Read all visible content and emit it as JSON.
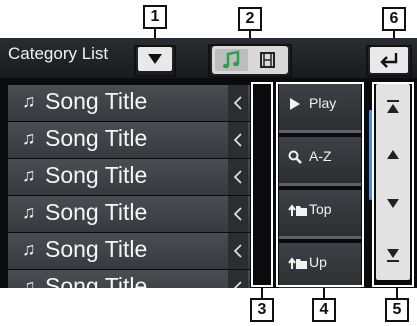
{
  "callouts": [
    "1",
    "2",
    "6",
    "3",
    "4",
    "5"
  ],
  "header": {
    "title": "Category List"
  },
  "list": {
    "items": [
      {
        "icon": "music-note-icon",
        "label": "Song Title"
      },
      {
        "icon": "music-note-icon",
        "label": "Song Title"
      },
      {
        "icon": "music-note-icon",
        "label": "Song Title"
      },
      {
        "icon": "music-note-icon",
        "label": "Song Title"
      },
      {
        "icon": "music-note-icon",
        "label": "Song Title"
      },
      {
        "icon": "music-note-icon",
        "label": "Song Title"
      }
    ]
  },
  "actions": {
    "items": [
      {
        "icon": "play-icon",
        "label": "Play"
      },
      {
        "icon": "search-icon",
        "label": "A-Z"
      },
      {
        "icon": "folder-up-icon",
        "label": "Top"
      },
      {
        "icon": "folder-up-icon",
        "label": "Up"
      }
    ]
  },
  "icons": {
    "note": "♫"
  },
  "colors": {
    "accent_green": "#2aa44a",
    "scroll_blue": "#4c8fd6"
  }
}
